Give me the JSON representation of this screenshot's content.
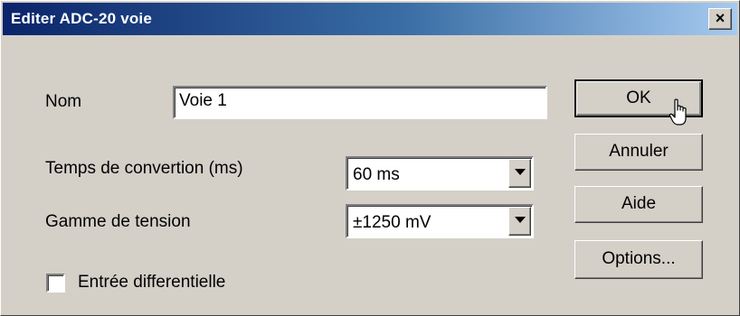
{
  "window": {
    "title": "Editer ADC-20 voie",
    "close_label": "×"
  },
  "form": {
    "name_label": "Nom",
    "name_value": "Voie 1",
    "conversion_label": "Temps de convertion (ms)",
    "conversion_value": "60 ms",
    "range_label": "Gamme de tension",
    "range_value": "±1250 mV",
    "differential_label": "Entrée differentielle",
    "differential_checked": false
  },
  "buttons": {
    "ok": "OK",
    "cancel": "Annuler",
    "help": "Aide",
    "options": "Options..."
  },
  "icons": {
    "close": "close-icon",
    "dropdown": "chevron-down-icon",
    "cursor": "hand-pointer-icon"
  },
  "colors": {
    "face": "#d4d0c8",
    "title_start": "#0a246a",
    "title_end": "#a6caf0"
  }
}
